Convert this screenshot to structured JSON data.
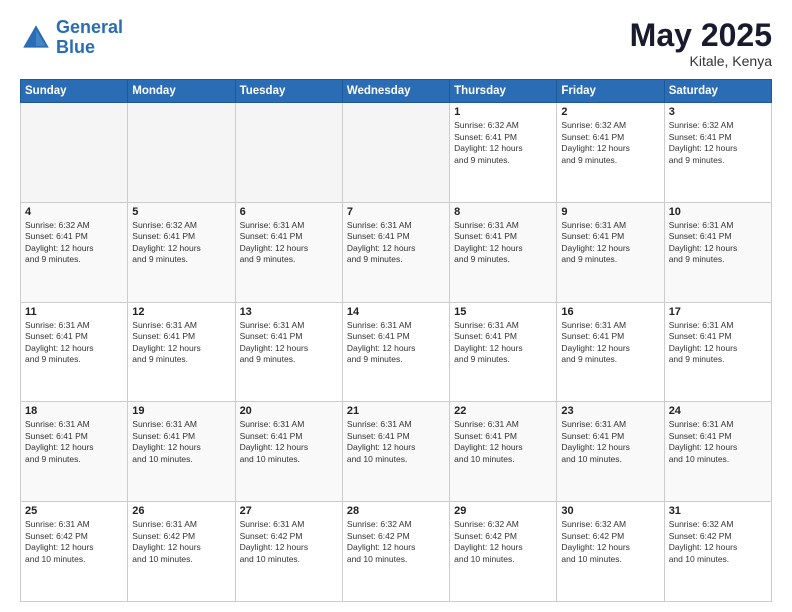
{
  "header": {
    "logo_line1": "General",
    "logo_line2": "Blue",
    "month": "May 2025",
    "location": "Kitale, Kenya"
  },
  "weekdays": [
    "Sunday",
    "Monday",
    "Tuesday",
    "Wednesday",
    "Thursday",
    "Friday",
    "Saturday"
  ],
  "weeks": [
    [
      {
        "day": "",
        "info": ""
      },
      {
        "day": "",
        "info": ""
      },
      {
        "day": "",
        "info": ""
      },
      {
        "day": "",
        "info": ""
      },
      {
        "day": "1",
        "info": "Sunrise: 6:32 AM\nSunset: 6:41 PM\nDaylight: 12 hours\nand 9 minutes."
      },
      {
        "day": "2",
        "info": "Sunrise: 6:32 AM\nSunset: 6:41 PM\nDaylight: 12 hours\nand 9 minutes."
      },
      {
        "day": "3",
        "info": "Sunrise: 6:32 AM\nSunset: 6:41 PM\nDaylight: 12 hours\nand 9 minutes."
      }
    ],
    [
      {
        "day": "4",
        "info": "Sunrise: 6:32 AM\nSunset: 6:41 PM\nDaylight: 12 hours\nand 9 minutes."
      },
      {
        "day": "5",
        "info": "Sunrise: 6:32 AM\nSunset: 6:41 PM\nDaylight: 12 hours\nand 9 minutes."
      },
      {
        "day": "6",
        "info": "Sunrise: 6:31 AM\nSunset: 6:41 PM\nDaylight: 12 hours\nand 9 minutes."
      },
      {
        "day": "7",
        "info": "Sunrise: 6:31 AM\nSunset: 6:41 PM\nDaylight: 12 hours\nand 9 minutes."
      },
      {
        "day": "8",
        "info": "Sunrise: 6:31 AM\nSunset: 6:41 PM\nDaylight: 12 hours\nand 9 minutes."
      },
      {
        "day": "9",
        "info": "Sunrise: 6:31 AM\nSunset: 6:41 PM\nDaylight: 12 hours\nand 9 minutes."
      },
      {
        "day": "10",
        "info": "Sunrise: 6:31 AM\nSunset: 6:41 PM\nDaylight: 12 hours\nand 9 minutes."
      }
    ],
    [
      {
        "day": "11",
        "info": "Sunrise: 6:31 AM\nSunset: 6:41 PM\nDaylight: 12 hours\nand 9 minutes."
      },
      {
        "day": "12",
        "info": "Sunrise: 6:31 AM\nSunset: 6:41 PM\nDaylight: 12 hours\nand 9 minutes."
      },
      {
        "day": "13",
        "info": "Sunrise: 6:31 AM\nSunset: 6:41 PM\nDaylight: 12 hours\nand 9 minutes."
      },
      {
        "day": "14",
        "info": "Sunrise: 6:31 AM\nSunset: 6:41 PM\nDaylight: 12 hours\nand 9 minutes."
      },
      {
        "day": "15",
        "info": "Sunrise: 6:31 AM\nSunset: 6:41 PM\nDaylight: 12 hours\nand 9 minutes."
      },
      {
        "day": "16",
        "info": "Sunrise: 6:31 AM\nSunset: 6:41 PM\nDaylight: 12 hours\nand 9 minutes."
      },
      {
        "day": "17",
        "info": "Sunrise: 6:31 AM\nSunset: 6:41 PM\nDaylight: 12 hours\nand 9 minutes."
      }
    ],
    [
      {
        "day": "18",
        "info": "Sunrise: 6:31 AM\nSunset: 6:41 PM\nDaylight: 12 hours\nand 9 minutes."
      },
      {
        "day": "19",
        "info": "Sunrise: 6:31 AM\nSunset: 6:41 PM\nDaylight: 12 hours\nand 10 minutes."
      },
      {
        "day": "20",
        "info": "Sunrise: 6:31 AM\nSunset: 6:41 PM\nDaylight: 12 hours\nand 10 minutes."
      },
      {
        "day": "21",
        "info": "Sunrise: 6:31 AM\nSunset: 6:41 PM\nDaylight: 12 hours\nand 10 minutes."
      },
      {
        "day": "22",
        "info": "Sunrise: 6:31 AM\nSunset: 6:41 PM\nDaylight: 12 hours\nand 10 minutes."
      },
      {
        "day": "23",
        "info": "Sunrise: 6:31 AM\nSunset: 6:41 PM\nDaylight: 12 hours\nand 10 minutes."
      },
      {
        "day": "24",
        "info": "Sunrise: 6:31 AM\nSunset: 6:41 PM\nDaylight: 12 hours\nand 10 minutes."
      }
    ],
    [
      {
        "day": "25",
        "info": "Sunrise: 6:31 AM\nSunset: 6:42 PM\nDaylight: 12 hours\nand 10 minutes."
      },
      {
        "day": "26",
        "info": "Sunrise: 6:31 AM\nSunset: 6:42 PM\nDaylight: 12 hours\nand 10 minutes."
      },
      {
        "day": "27",
        "info": "Sunrise: 6:31 AM\nSunset: 6:42 PM\nDaylight: 12 hours\nand 10 minutes."
      },
      {
        "day": "28",
        "info": "Sunrise: 6:32 AM\nSunset: 6:42 PM\nDaylight: 12 hours\nand 10 minutes."
      },
      {
        "day": "29",
        "info": "Sunrise: 6:32 AM\nSunset: 6:42 PM\nDaylight: 12 hours\nand 10 minutes."
      },
      {
        "day": "30",
        "info": "Sunrise: 6:32 AM\nSunset: 6:42 PM\nDaylight: 12 hours\nand 10 minutes."
      },
      {
        "day": "31",
        "info": "Sunrise: 6:32 AM\nSunset: 6:42 PM\nDaylight: 12 hours\nand 10 minutes."
      }
    ]
  ]
}
